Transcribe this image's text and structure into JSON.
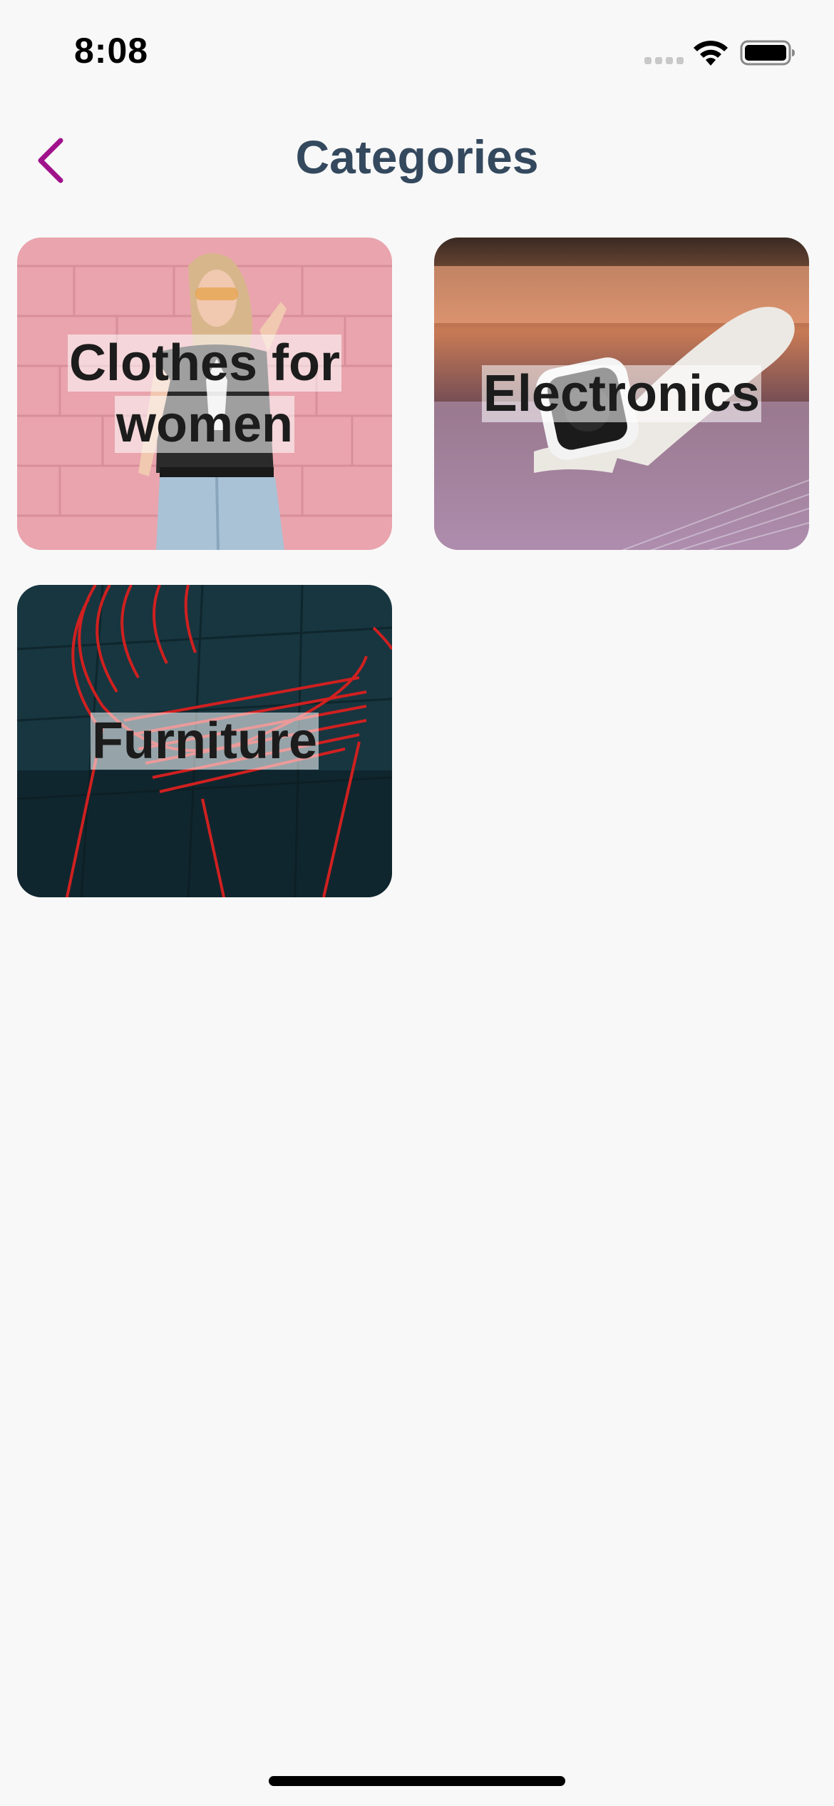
{
  "status_bar": {
    "time": "8:08"
  },
  "header": {
    "title": "Categories",
    "back_icon": "chevron-left-icon"
  },
  "categories": [
    {
      "label": "Clothes for women",
      "image": "woman-pink-wall-photo"
    },
    {
      "label": "Electronics",
      "image": "smartwatch-photo"
    },
    {
      "label": "Furniture",
      "image": "red-wire-chair-photo"
    }
  ],
  "colors": {
    "accent": "#a0128b",
    "title": "#34495e",
    "background": "#f8f8f8"
  }
}
